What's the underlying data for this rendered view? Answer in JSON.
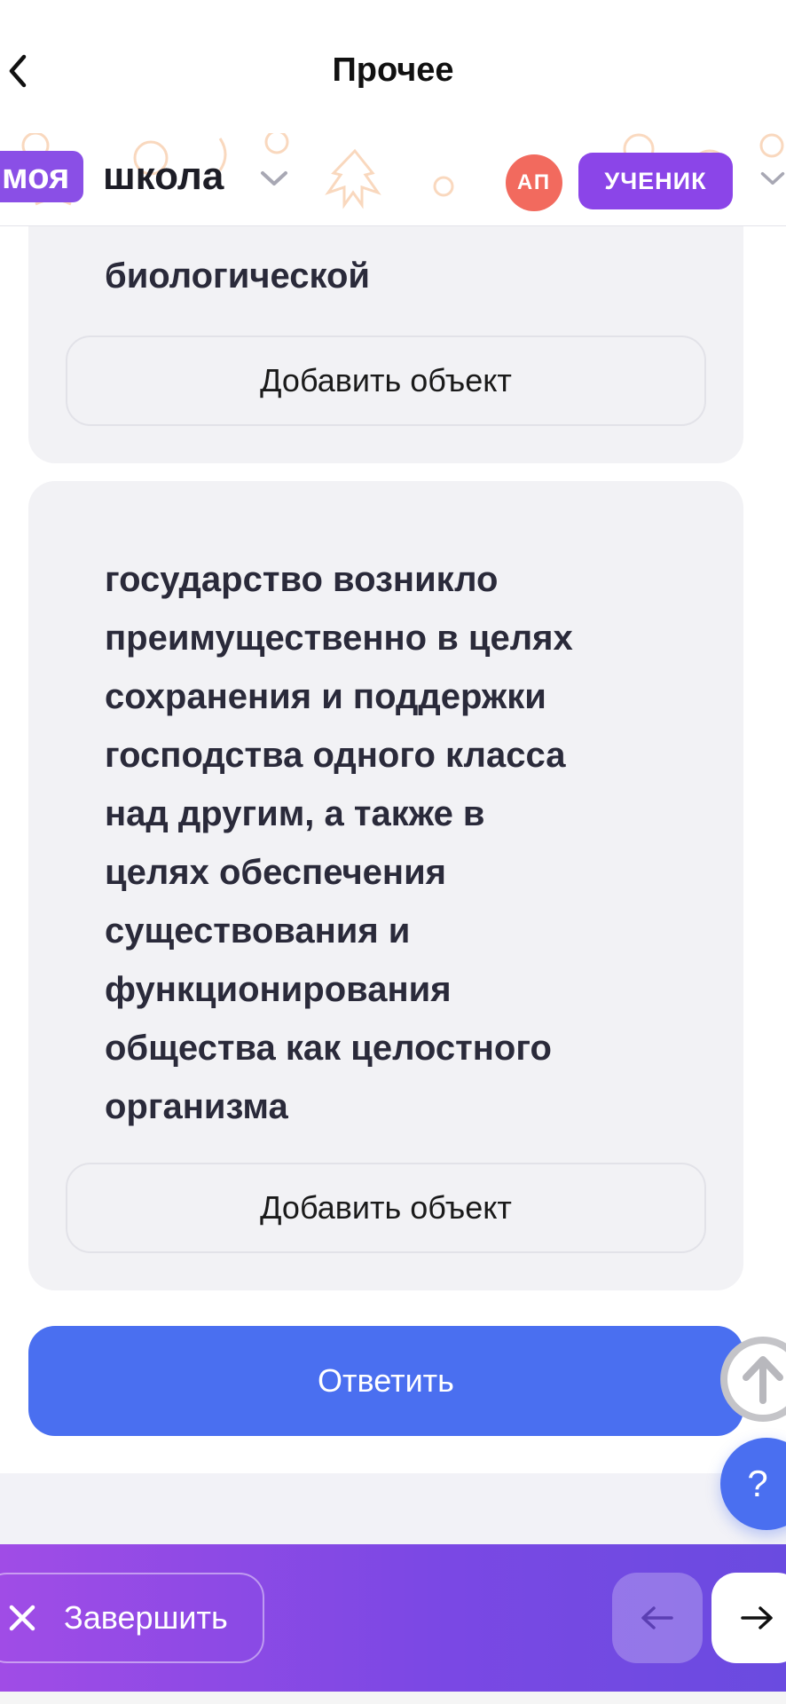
{
  "header": {
    "title": "Прочее",
    "back_icon": "chevron-left-icon"
  },
  "school_bar": {
    "logo_badge": "моя",
    "logo_text": "школа",
    "avatar_initials": "АП",
    "role": "УЧЕНИК"
  },
  "cards": [
    {
      "text_tail": "биологической",
      "add_label": "Добавить объект"
    },
    {
      "text_lines": [
        "государство возникло",
        "преимущественно в целях",
        "сохранения и поддержки",
        "господства одного класса",
        "над другим, а также в",
        "целях обеспечения",
        "существования и",
        "функционирования",
        "общества как целостного",
        "организма"
      ],
      "add_label": "Добавить объект"
    }
  ],
  "answer_label": "Ответить",
  "help_label": "?",
  "footer": {
    "finish_label": "Завершить"
  },
  "colors": {
    "accent_blue": "#4a6ff0",
    "purple": "#8b45e8",
    "avatar_red": "#f26a5e"
  }
}
